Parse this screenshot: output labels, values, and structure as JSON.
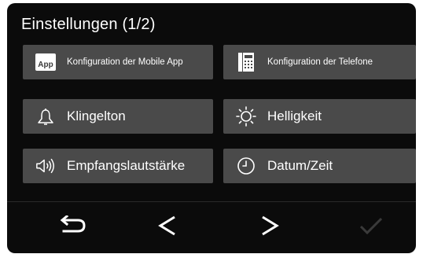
{
  "header": {
    "title": "Einstellungen (1/2)"
  },
  "buttons": {
    "mobile_app": {
      "label": "Konfiguration der Mobile App",
      "icon": "app-icon",
      "icon_text": "App"
    },
    "telefone": {
      "label": "Konfiguration der Telefone",
      "icon": "desk-phone-icon"
    },
    "klingelton": {
      "label": "Klingelton",
      "icon": "bell-icon"
    },
    "helligkeit": {
      "label": "Helligkeit",
      "icon": "sun-icon"
    },
    "lautstaerke": {
      "label": "Empfangslautstärke",
      "icon": "speaker-icon"
    },
    "datum_zeit": {
      "label": "Datum/Zeit",
      "icon": "clock-icon"
    }
  },
  "nav": {
    "back": "back-arrow-icon",
    "prev": "chevron-left-icon",
    "next": "chevron-right-icon",
    "confirm": "checkmark-icon"
  },
  "colors": {
    "background": "#0b0b0b",
    "button": "#4a4a4a",
    "text": "#ffffff",
    "disabled": "#3a3a3a"
  }
}
